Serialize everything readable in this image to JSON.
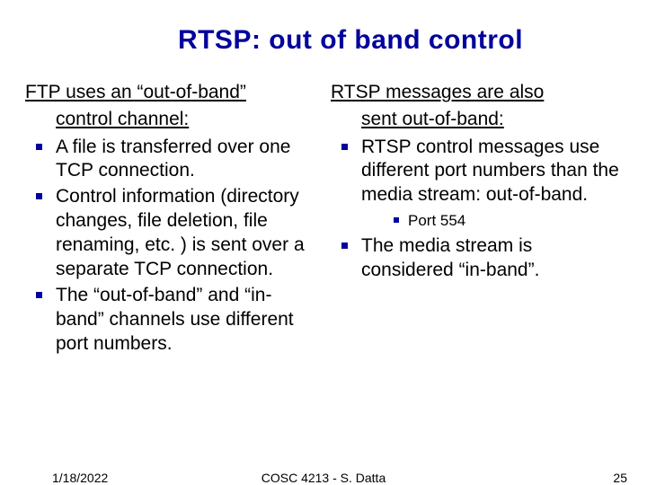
{
  "title": "RTSP: out of band control",
  "left": {
    "lead_l1": "FTP uses an “out-of-band”",
    "lead_l2": "control channel:",
    "items": [
      "A file is transferred over one TCP connection.",
      "Control information (directory changes, file deletion, file renaming, etc. ) is sent over a separate TCP connection.",
      "The “out-of-band” and “in-band” channels use different port numbers."
    ]
  },
  "right": {
    "lead_l1": "RTSP messages are also",
    "lead_l2": "sent out-of-band:",
    "item1": " RTSP control messages use different port numbers than the media stream: out-of-band.",
    "sub1": "Port 554",
    "item2": "The media stream is considered “in-band”."
  },
  "footer": {
    "date": "1/18/2022",
    "center": "COSC 4213 - S. Datta",
    "page": "25"
  }
}
